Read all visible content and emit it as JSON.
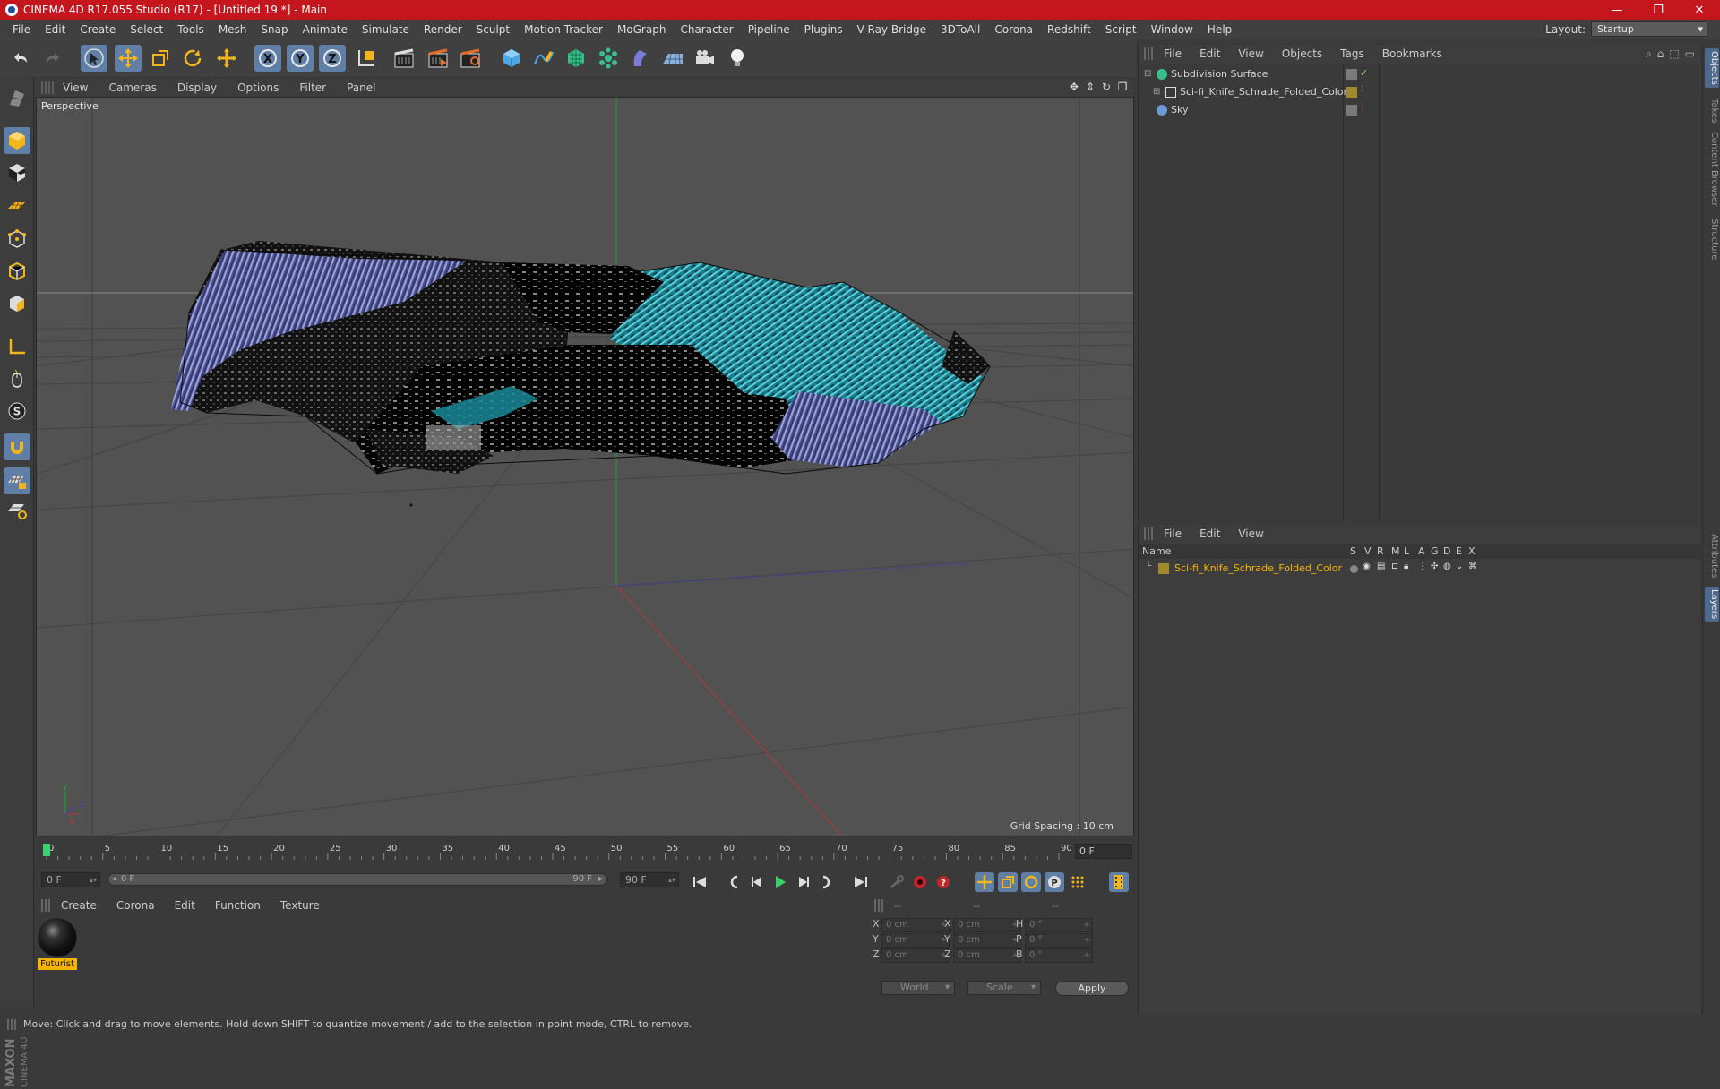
{
  "window": {
    "title": "CINEMA 4D R17.055 Studio (R17) - [Untitled 19 *] - Main",
    "minimize": "—",
    "restore": "❐",
    "close": "✕"
  },
  "menu": [
    "File",
    "Edit",
    "Create",
    "Select",
    "Tools",
    "Mesh",
    "Snap",
    "Animate",
    "Simulate",
    "Render",
    "Sculpt",
    "Motion Tracker",
    "MoGraph",
    "Character",
    "Pipeline",
    "Plugins",
    "V-Ray Bridge",
    "3DToAll",
    "Corona",
    "Redshift",
    "Script",
    "Window",
    "Help"
  ],
  "layout": {
    "label": "Layout:",
    "value": "Startup"
  },
  "viewport": {
    "menu": [
      "View",
      "Cameras",
      "Display",
      "Options",
      "Filter",
      "Panel"
    ],
    "camera_label": "Perspective",
    "grid_spacing": "Grid Spacing : 10 cm"
  },
  "timeline": {
    "ticks": [
      "0",
      "5",
      "10",
      "15",
      "20",
      "25",
      "30",
      "35",
      "40",
      "45",
      "50",
      "55",
      "60",
      "65",
      "70",
      "75",
      "80",
      "85",
      "90"
    ],
    "current_frame": "0 F",
    "start_field": "0 F",
    "range_start": "0 F",
    "range_end": "90 F",
    "end_field": "90 F"
  },
  "material_panel": {
    "menu": [
      "Create",
      "Corona",
      "Edit",
      "Function",
      "Texture"
    ],
    "materials": [
      {
        "name": "Futurist"
      }
    ]
  },
  "coordinates": {
    "header": [
      "--",
      "--",
      "--"
    ],
    "rows": [
      {
        "a": "X",
        "av": "0 cm",
        "b": "X",
        "bv": "0 cm",
        "c": "H",
        "cv": "0 °"
      },
      {
        "a": "Y",
        "av": "0 cm",
        "b": "Y",
        "bv": "0 cm",
        "c": "P",
        "cv": "0 °"
      },
      {
        "a": "Z",
        "av": "0 cm",
        "b": "Z",
        "bv": "0 cm",
        "c": "B",
        "cv": "0 °"
      }
    ],
    "mode_select": "World",
    "scale_select": "Scale",
    "apply": "Apply"
  },
  "object_manager": {
    "menu": [
      "File",
      "Edit",
      "View",
      "Objects",
      "Tags",
      "Bookmarks"
    ],
    "objects": [
      {
        "name": "Subdivision Surface",
        "icon_color": "#35c08c"
      },
      {
        "name": "Sci-fi_Knife_Schrade_Folded_Color",
        "icon_color": "#8a8a8a"
      },
      {
        "name": "Sky",
        "icon_color": "#6c9ad6"
      }
    ]
  },
  "layer_manager": {
    "menu": [
      "File",
      "Edit",
      "View"
    ],
    "columns": [
      "Name",
      "S",
      "V",
      "R",
      "M",
      "L",
      "A",
      "G",
      "D",
      "E",
      "X"
    ],
    "layers": [
      {
        "name": "Sci-fi_Knife_Schrade_Folded_Color",
        "color": "#f5b400"
      }
    ]
  },
  "right_tabs": [
    "Objects",
    "Takes",
    "Content Browser",
    "Structure",
    "Attributes",
    "Layers"
  ],
  "status": "Move: Click and drag to move elements. Hold down SHIFT to quantize movement / add to the selection in point mode, CTRL to remove.",
  "brand": {
    "maxon": "MAXON",
    "product": "CINEMA 4D"
  },
  "colors": {
    "accent": "#5f7fa6",
    "titlebar": "#c4161c",
    "layer_highlight": "#f5b400"
  }
}
